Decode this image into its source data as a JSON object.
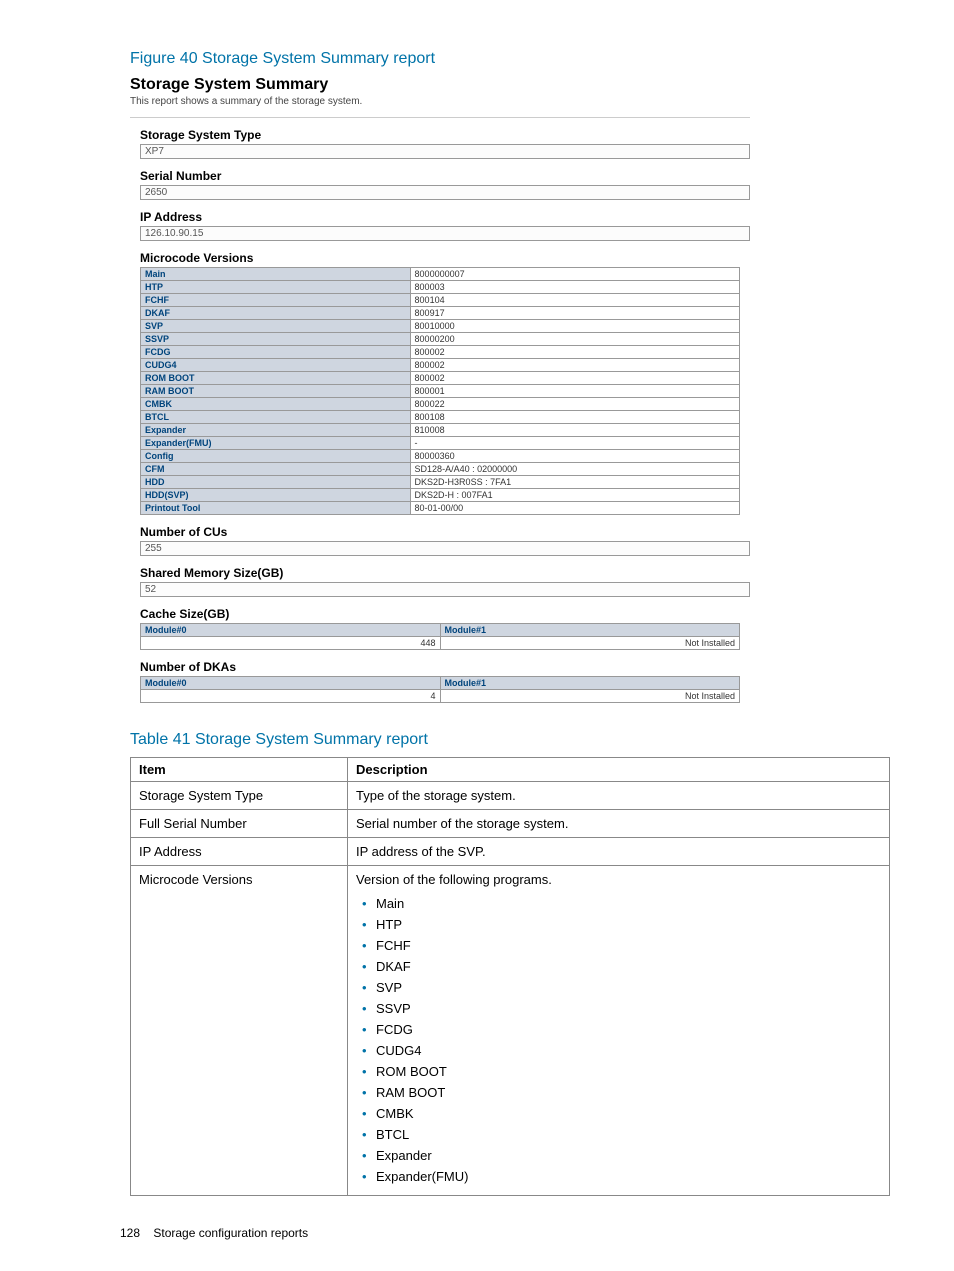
{
  "figure_title": "Figure 40 Storage System Summary report",
  "report": {
    "heading": "Storage System Summary",
    "subtitle": "This report shows a summary of the storage system.",
    "storage_type_label": "Storage System Type",
    "storage_type_value": "XP7",
    "serial_label": "Serial Number",
    "serial_value": "2650",
    "ip_label": "IP Address",
    "ip_value": "126.10.90.15",
    "microcode_label": "Microcode Versions",
    "microcode": [
      {
        "k": "Main",
        "v": "8000000007"
      },
      {
        "k": "HTP",
        "v": "800003"
      },
      {
        "k": "FCHF",
        "v": "800104"
      },
      {
        "k": "DKAF",
        "v": "800917"
      },
      {
        "k": "SVP",
        "v": "80010000"
      },
      {
        "k": "SSVP",
        "v": "80000200"
      },
      {
        "k": "FCDG",
        "v": "800002"
      },
      {
        "k": "CUDG4",
        "v": "800002"
      },
      {
        "k": "ROM BOOT",
        "v": "800002"
      },
      {
        "k": "RAM BOOT",
        "v": "800001"
      },
      {
        "k": "CMBK",
        "v": "800022"
      },
      {
        "k": "BTCL",
        "v": "800108"
      },
      {
        "k": "Expander",
        "v": "810008"
      },
      {
        "k": "Expander(FMU)",
        "v": "-"
      },
      {
        "k": "Config",
        "v": "80000360"
      },
      {
        "k": "CFM",
        "v": "SD128-A/A40 : 02000000"
      },
      {
        "k": "HDD",
        "v": "DKS2D-H3R0SS : 7FA1"
      },
      {
        "k": "HDD(SVP)",
        "v": "DKS2D-H : 007FA1"
      },
      {
        "k": "Printout Tool",
        "v": "80-01-00/00"
      }
    ],
    "cus_label": "Number of CUs",
    "cus_value": "255",
    "shm_label": "Shared Memory Size(GB)",
    "shm_value": "52",
    "cache_label": "Cache Size(GB)",
    "mod0": "Module#0",
    "mod1": "Module#1",
    "cache_mod0": "448",
    "cache_mod1": "Not Installed",
    "dkas_label": "Number of DKAs",
    "dkas_mod0": "4",
    "dkas_mod1": "Not Installed"
  },
  "table_title": "Table 41 Storage System Summary report",
  "desc_headers": {
    "item": "Item",
    "desc": "Description"
  },
  "desc_rows": {
    "r1": {
      "item": "Storage System Type",
      "desc": "Type of the storage system."
    },
    "r2": {
      "item": "Full Serial Number",
      "desc": "Serial number of the storage system."
    },
    "r3": {
      "item": "IP Address",
      "desc": "IP address of the SVP."
    },
    "r4": {
      "item": "Microcode Versions",
      "desc": "Version of the following programs.",
      "bullets": [
        "Main",
        "HTP",
        "FCHF",
        "DKAF",
        "SVP",
        "SSVP",
        "FCDG",
        "CUDG4",
        "ROM BOOT",
        "RAM BOOT",
        "CMBK",
        "BTCL",
        "Expander",
        "Expander(FMU)"
      ]
    }
  },
  "footer": {
    "page": "128",
    "text": "Storage configuration reports"
  }
}
